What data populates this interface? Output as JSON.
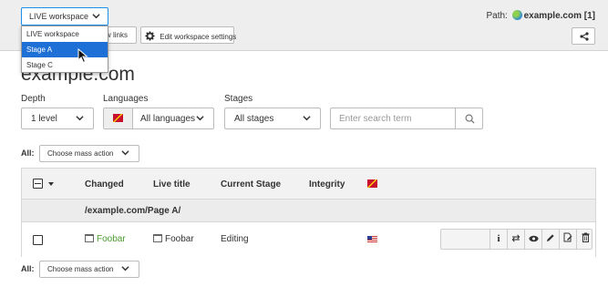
{
  "header": {
    "workspace_select": "LIVE workspace",
    "view_links_label": "w links",
    "edit_settings_label": "Edit workspace settings",
    "path_label": "Path:",
    "path_value": "example.com [1]"
  },
  "workspace_dropdown": {
    "options": [
      "LIVE workspace",
      "Stage A",
      "Stage C"
    ],
    "highlighted": "Stage A"
  },
  "page_title": "example.com",
  "filters": {
    "depth_label": "Depth",
    "depth_value": "1 level",
    "languages_label": "Languages",
    "languages_value": "All languages",
    "stages_label": "Stages",
    "stages_value": "All stages",
    "search_placeholder": "Enter search term"
  },
  "mass_action": {
    "all_label": "All:",
    "button_label": "Choose mass action"
  },
  "table": {
    "columns": [
      "Changed",
      "Live title",
      "Current Stage",
      "Integrity"
    ],
    "group_path": "/example.com/Page A/",
    "rows": [
      {
        "changed": "Foobar",
        "live_title": "Foobar",
        "current_stage": "Editing"
      }
    ]
  },
  "icons": {
    "chevron": "chevron-down-icon",
    "actions": [
      "info-icon",
      "swap-icon",
      "eye-icon",
      "pencil-icon",
      "document-edit-icon",
      "trash-icon"
    ]
  },
  "colors": {
    "accent": "#1e6fd6",
    "changed_text": "#4a9a2e",
    "header_bg": "#eeeeee"
  }
}
